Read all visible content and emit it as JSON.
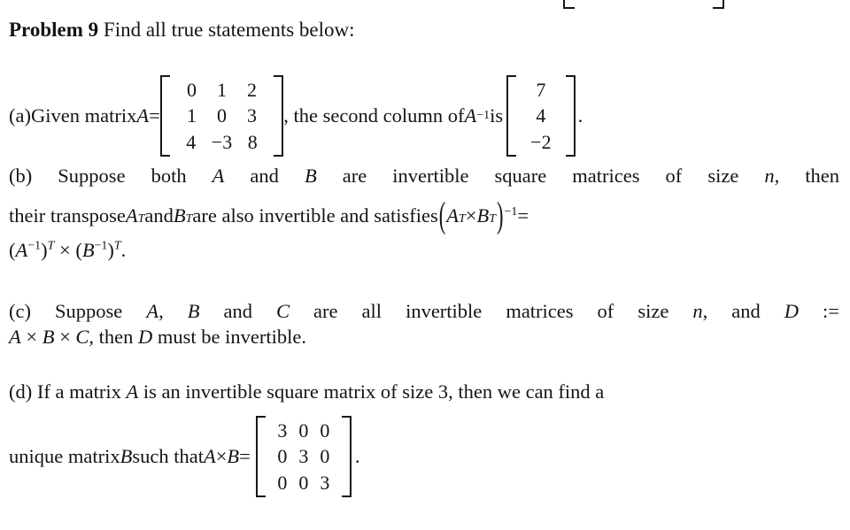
{
  "document": {
    "problem_label": "Problem 9",
    "prompt": "Find all true statements below:",
    "clipped_bracket_note": "partial matrix bracket bottoms visible at top edge"
  },
  "parts": {
    "a": {
      "marker": "(a)",
      "text_before_matrix": "Given matrix ",
      "var_A": "A",
      "equals": " = ",
      "matrix_A": {
        "rows": [
          [
            "0",
            "1",
            "2"
          ],
          [
            "1",
            "0",
            "3"
          ],
          [
            "4",
            "−3",
            "8"
          ]
        ]
      },
      "text_middle_1": ", the second column of ",
      "var_A2": "A",
      "sup_inv": "−1",
      "text_middle_2": " is ",
      "column_vector": {
        "rows": [
          [
            "7"
          ],
          [
            "4"
          ],
          [
            "−2"
          ]
        ]
      },
      "text_end": "."
    },
    "b": {
      "marker": "(b)",
      "line1": "Suppose both A and B are invertible square matrices of size n, then",
      "seg1": "Suppose both ",
      "var_A": "A",
      "seg2": " and ",
      "var_B": "B",
      "seg3": " are invertible square matrices of size ",
      "var_n": "n",
      "seg4": ", then",
      "seg5": "their transpose ",
      "var_AT": "A",
      "sup_T1": "T",
      "seg6": " and ",
      "var_BT": "B",
      "sup_T2": "T",
      "seg7": " are also invertible and satisfies ",
      "expr_open": "(",
      "expr_A": "A",
      "expr_supT1": "T",
      "expr_times": " × ",
      "expr_B": "B",
      "expr_supT2": "T",
      "expr_close": ")",
      "expr_supinv": "−1",
      "expr_equals": " =",
      "line3_open1": "(",
      "line3_A": "A",
      "line3_supinv1": "−1",
      "line3_close1": ")",
      "line3_supT1": "T",
      "line3_times": " × ",
      "line3_open2": "(",
      "line3_B": "B",
      "line3_supinv2": "−1",
      "line3_close2": ")",
      "line3_supT2": "T",
      "line3_period": "."
    },
    "c": {
      "marker": "(c)",
      "seg1": "Suppose ",
      "var_A": "A",
      "seg2": ", ",
      "var_B": "B",
      "seg3": " and ",
      "var_C": "C",
      "seg4": " are all invertible matrices of size ",
      "var_n": "n",
      "seg5": ", and ",
      "var_D": "D",
      "seg6": " :=",
      "line2_A": "A",
      "line2_t1": " × ",
      "line2_B": "B",
      "line2_t2": " × ",
      "line2_C": "C",
      "line2_seg": ", then ",
      "line2_D": "D",
      "line2_end": " must be invertible."
    },
    "d": {
      "marker": "(d)",
      "seg1": "If a matrix ",
      "var_A": "A",
      "seg2": " is an invertible square matrix of size 3, then we can find a",
      "seg3": "unique matrix ",
      "var_B": "B",
      "seg4": " such that ",
      "var_A2": "A",
      "times": " × ",
      "var_B2": "B",
      "equals": "= ",
      "matrix_B": {
        "rows": [
          [
            "3",
            "0",
            "0"
          ],
          [
            "0",
            "3",
            "0"
          ],
          [
            "0",
            "0",
            "3"
          ]
        ]
      },
      "period": "."
    }
  },
  "style": {
    "text_color": "#141414",
    "background": "#ffffff",
    "bracket_color": "#17171b"
  }
}
